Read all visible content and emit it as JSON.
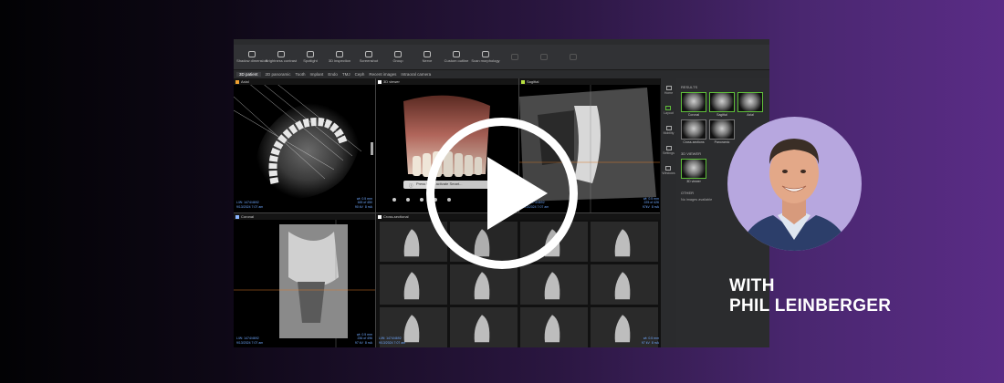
{
  "presenter": {
    "prefix": "WITH",
    "name": "PHIL LEINBERGER"
  },
  "video": {
    "play_icon": "play-icon"
  },
  "app": {
    "ribbon": [
      {
        "label": "Shadow dimension"
      },
      {
        "label": "Brightness contrast"
      },
      {
        "label": "Spotlight"
      },
      {
        "label": "3D inspection"
      },
      {
        "label": "Screenshot"
      },
      {
        "label": "Group"
      },
      {
        "label": "Nerve"
      },
      {
        "label": "Custom outline"
      },
      {
        "label": "Scan morphology"
      }
    ],
    "tabs": [
      "3D patient",
      "2D panoramic",
      "Tooth",
      "Implant",
      "Endo",
      "TMJ",
      "Ceph",
      "Recent images",
      "Intraoral camera"
    ],
    "panes": [
      {
        "title": "Axial",
        "color": "#f0a030",
        "info_left": "L/W: 1474/4692\n9/13/2024 7:07 am",
        "info_right": "wt: 0.5 mm\n165 of 450\n90 kV  8 mA"
      },
      {
        "title": "3D viewer",
        "color": "#ffffff",
        "info_left": "",
        "info_right": "",
        "notice": "Press F2 to activate Smart..."
      },
      {
        "title": "Sagittal",
        "color": "#b8e040",
        "info_left": "L/W: 1474/4692\n9/13/2024 7:07 am",
        "info_right": "wt: 0.5 mm\n225 of 426\n97kV  8 mA"
      },
      {
        "title": "Coronal",
        "color": "#8ab4ff",
        "info_left": "L/W: 1474/4692\n9/13/2024 7:07 am",
        "info_right": "wt: 0.5 mm\n236 of 496\n97 kV  8 mA"
      },
      {
        "title": "Cross-sectional",
        "color": "#ffffff",
        "info_left": "L/W: 1474/4692\n9/13/2024 7:07 am",
        "info_right": "wt: 0.5 mm\n97 kV  8 mA"
      },
      {
        "title": "",
        "color": "#ffffff",
        "info_left": "",
        "info_right": ""
      }
    ],
    "sidebar": [
      "Home",
      "Layout",
      "Mobility",
      "Settings",
      "Windows"
    ],
    "results": {
      "heading": "RESULTS",
      "thumbs": [
        "Coronal",
        "Sagittal",
        "Axial",
        "Cross-sections",
        "Panoramic"
      ],
      "viewer_heading": "3D VIEWER",
      "viewer_thumb": "3D viewer",
      "other_heading": "OTHER",
      "other_text": "No images available"
    }
  },
  "colors": {
    "background_left": "#020204",
    "background_right": "#5a2c86",
    "avatar_bg": "#b7a7df",
    "accent_green": "#5fbf3a"
  }
}
